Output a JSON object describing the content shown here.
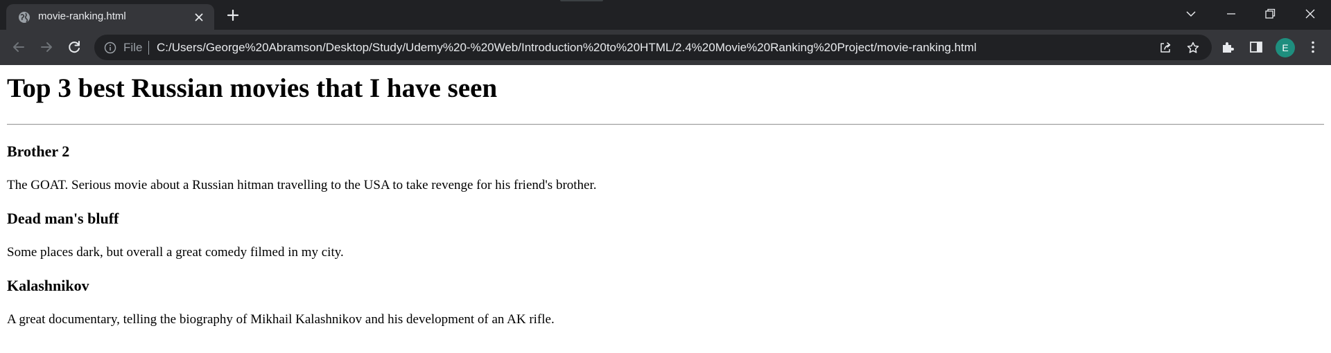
{
  "browser": {
    "tab": {
      "title": "movie-ranking.html",
      "favicon": "globe-icon"
    },
    "address_bar": {
      "scheme_label": "File",
      "url": "C:/Users/George%20Abramson/Desktop/Study/Udemy%20-%20Web/Introduction%20to%20HTML/2.4%20Movie%20Ranking%20Project/movie-ranking.html"
    },
    "profile_initial": "E",
    "colors": {
      "tabstrip_bg": "#202124",
      "toolbar_bg": "#35363a",
      "omnibox_bg": "#202124",
      "avatar_bg": "#1e8e7e"
    }
  },
  "page": {
    "heading": "Top 3 best Russian movies that I have seen",
    "movies": [
      {
        "title": "Brother 2",
        "description": "The GOAT. Serious movie about a Russian hitman travelling to the USA to take revenge for his friend's brother."
      },
      {
        "title": "Dead man's bluff",
        "description": "Some places dark, but overall a great comedy filmed in my city."
      },
      {
        "title": "Kalashnikov",
        "description": "A great documentary, telling the biography of Mikhail Kalashnikov and his development of an AK rifle."
      }
    ]
  }
}
